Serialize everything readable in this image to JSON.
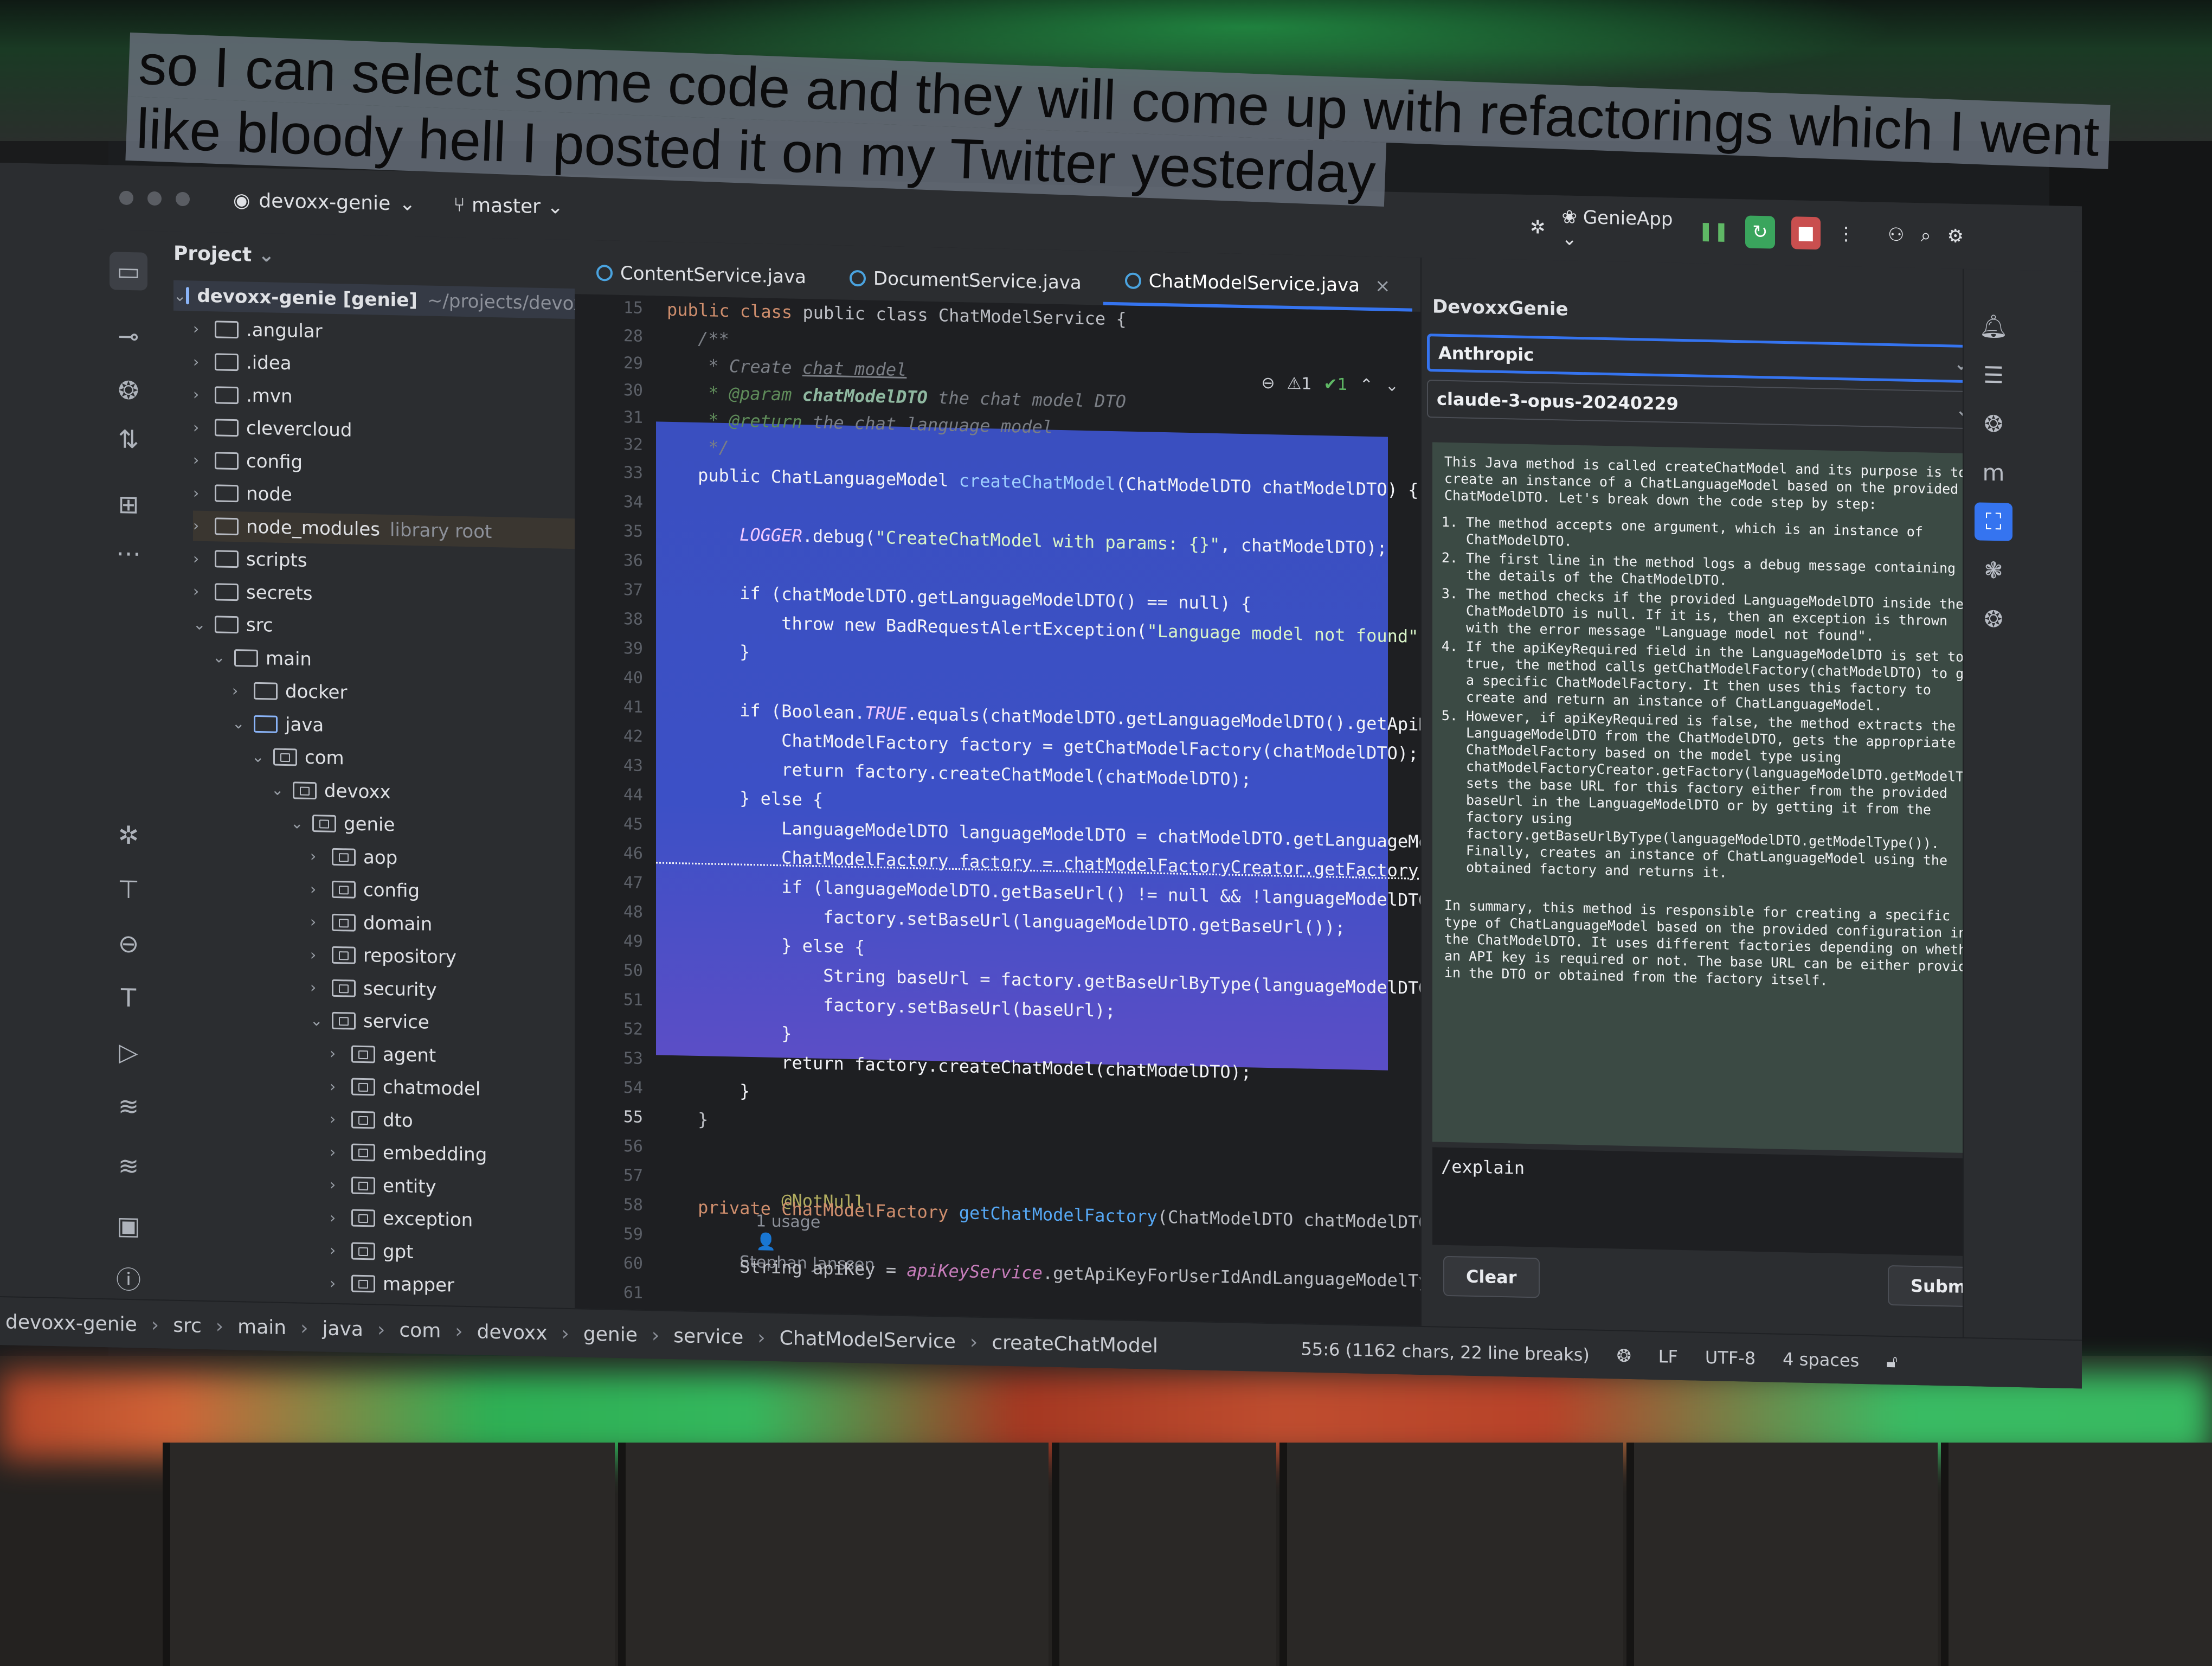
{
  "caption": {
    "line1": "so I can select some code and they will come up with refactorings which I went",
    "line2": "like bloody hell I posted it on my Twitter yesterday"
  },
  "titlebar": {
    "project_name": "devoxx-genie",
    "branch": "master"
  },
  "project_panel": {
    "title": "Project",
    "tree": [
      {
        "label": "devoxx-genie [genie]",
        "hint": "~/projects/devoxx",
        "depth": 0,
        "expanded": true,
        "kind": "module"
      },
      {
        "label": ".angular",
        "depth": 1,
        "kind": "folder"
      },
      {
        "label": ".idea",
        "depth": 1,
        "kind": "folder"
      },
      {
        "label": ".mvn",
        "depth": 1,
        "kind": "folder"
      },
      {
        "label": "clevercloud",
        "depth": 1,
        "kind": "folder"
      },
      {
        "label": "config",
        "depth": 1,
        "kind": "folder"
      },
      {
        "label": "node",
        "depth": 1,
        "kind": "folder"
      },
      {
        "label": "node_modules",
        "hint": "library root",
        "depth": 1,
        "kind": "folder"
      },
      {
        "label": "scripts",
        "depth": 1,
        "kind": "folder"
      },
      {
        "label": "secrets",
        "depth": 1,
        "kind": "folder"
      },
      {
        "label": "src",
        "depth": 1,
        "expanded": true,
        "kind": "folder"
      },
      {
        "label": "main",
        "depth": 2,
        "expanded": true,
        "kind": "folder"
      },
      {
        "label": "docker",
        "depth": 3,
        "kind": "folder"
      },
      {
        "label": "java",
        "depth": 3,
        "expanded": true,
        "kind": "module"
      },
      {
        "label": "com",
        "depth": 4,
        "expanded": true,
        "kind": "package"
      },
      {
        "label": "devoxx",
        "depth": 5,
        "expanded": true,
        "kind": "package"
      },
      {
        "label": "genie",
        "depth": 6,
        "expanded": true,
        "kind": "package"
      },
      {
        "label": "aop",
        "depth": 7,
        "kind": "package"
      },
      {
        "label": "config",
        "depth": 7,
        "kind": "package"
      },
      {
        "label": "domain",
        "depth": 7,
        "kind": "package"
      },
      {
        "label": "repository",
        "depth": 7,
        "kind": "package"
      },
      {
        "label": "security",
        "depth": 7,
        "kind": "package"
      },
      {
        "label": "service",
        "depth": 7,
        "expanded": true,
        "kind": "package"
      },
      {
        "label": "agent",
        "depth": 8,
        "kind": "package"
      },
      {
        "label": "chatmodel",
        "depth": 8,
        "kind": "package"
      },
      {
        "label": "dto",
        "depth": 8,
        "kind": "package"
      },
      {
        "label": "embedding",
        "depth": 8,
        "kind": "package"
      },
      {
        "label": "entity",
        "depth": 8,
        "kind": "package"
      },
      {
        "label": "exception",
        "depth": 8,
        "kind": "package"
      },
      {
        "label": "gpt",
        "depth": 8,
        "kind": "package"
      },
      {
        "label": "mapper",
        "depth": 8,
        "kind": "package"
      }
    ]
  },
  "editor": {
    "tabs": [
      {
        "label": "ContentService.java",
        "active": false
      },
      {
        "label": "DocumentService.java",
        "active": false
      },
      {
        "label": "ChatModelService.java",
        "active": true,
        "close": "×"
      }
    ],
    "inspections": {
      "warnings": "⚠1",
      "ok": "✔1"
    },
    "line_numbers": [
      "15",
      "28",
      "29",
      "30",
      "31",
      "32",
      "33",
      "34",
      "35",
      "36",
      "37",
      "38",
      "39",
      "40",
      "41",
      "42",
      "43",
      "44",
      "45",
      "46",
      "47",
      "48",
      "49",
      "50",
      "51",
      "52",
      "53",
      "54",
      "55",
      "56",
      "57",
      "58",
      "59",
      "60",
      "61"
    ],
    "current_line": "55",
    "code": {
      "l15": "public class ChatModelService {",
      "l28": "    /**",
      "l29_a": "     * Create ",
      "l29_b": "chat model",
      "l30_a": "     * @param ",
      "l30_b": "chatModelDTO",
      "l30_c": " the chat model DTO",
      "l31_a": "     * @return",
      "l31_b": " the chat language model",
      "l32": "     */",
      "l33_a": "    public ChatLanguageModel ",
      "l33_b": "createChatModel",
      "l33_c": "(ChatModelDTO chatModelDTO) {",
      "l34": "",
      "l35_a": "        LOGGER",
      "l35_b": ".debug(",
      "l35_c": "\"CreateChatModel with params: {}\"",
      "l35_d": ", chatModelDTO);",
      "l36": "",
      "l37": "        if (chatModelDTO.getLanguageModelDTO() == null) {",
      "l38_a": "            throw new BadRequestAlertException(",
      "l38_b": "\"Language model not found\",",
      "l39": "        }",
      "l40": "",
      "l41_a": "        if (Boolean.",
      "l41_b": "TRUE",
      "l41_c": ".equals(chatModelDTO.getLanguageModelDTO().getApiKe",
      "l42": "            ChatModelFactory factory = getChatModelFactory(chatModelDTO);",
      "l43": "            return factory.createChatModel(chatModelDTO);",
      "l44": "        } else {",
      "l45": "            LanguageModelDTO languageModelDTO = chatModelDTO.getLanguageMod",
      "l46": "            ChatModelFactory factory = chatModelFactoryCreator.getFactory(l",
      "l47": "            if (languageModelDTO.getBaseUrl() != null && !languageModelDTO.",
      "l48": "                factory.setBaseUrl(languageModelDTO.getBaseUrl());",
      "l49": "            } else {",
      "l50": "                String baseUrl = factory.getBaseUrlByType(languageModelDTO.",
      "l51": "                factory.setBaseUrl(baseUrl);",
      "l52": "            }",
      "l53": "            return factory.createChatModel(chatModelDTO);",
      "l54": "        }",
      "l55": "    }",
      "l56": "",
      "l57_ann": "    @NotNull",
      "l57_meta1": "1 usage",
      "l57_meta2": "Stephan Janssen",
      "l58_a": "    private ChatModelFactory ",
      "l58_b": "getChatModelFactory",
      "l58_c": "(ChatModelDTO chatModelDTO) {",
      "l59": "",
      "l60_a": "        String apiKey = ",
      "l60_b": "apiKeyService",
      "l60_c": ".getApiKeyForUserIdAndLanguageModelTyp",
      "l61": ""
    }
  },
  "plugin": {
    "run_config": "GenieApp",
    "title": "DevoxxGenie",
    "provider": "Anthropic",
    "model": "claude-3-opus-20240229",
    "answer": {
      "intro": "This Java method is called createChatModel and its purpose is to create an instance of a ChatLanguageModel based on the provided ChatModelDTO. Let's break down the code step by step:",
      "steps": [
        "The method accepts one argument, which is an instance of ChatModelDTO.",
        "The first line in the method logs a debug message containing the details of the ChatModelDTO.",
        "The method checks if the provided LanguageModelDTO inside the ChatModelDTO is null. If it is, then an exception is thrown with the error message \"Language model not found\".",
        "If the apiKeyRequired field in the LanguageModelDTO is set to true, the method calls getChatModelFactory(chatModelDTO) to get a specific ChatModelFactory. It then uses this factory to create and return an instance of ChatLanguageModel.",
        "However, if apiKeyRequired is false, the method extracts the LanguageModelDTO from the ChatModelDTO, gets the appropriate ChatModelFactory based on the model type using chatModelFactoryCreator.getFactory(languageModelDTO.getModelType()), sets the base URL for this factory either from the provided baseUrl in the LanguageModelDTO or by getting it from the factory using factory.getBaseUrlByType(languageModelDTO.getModelType()). Finally, creates an instance of ChatLanguageModel using the obtained factory and returns it."
      ],
      "summary": "In summary, this method is responsible for creating a specific type of ChatLanguageModel based on the provided configuration in the ChatModelDTO. It uses different factories depending on whether an API key is required or not. The base URL can be either provided in the DTO or obtained from the factory itself."
    },
    "prompt": "/explain",
    "clear_label": "Clear",
    "submit_label": "Submit"
  },
  "statusbar": {
    "breadcrumb": [
      "devoxx-genie",
      "src",
      "main",
      "java",
      "com",
      "devoxx",
      "genie",
      "service",
      "ChatModelService",
      "createChatModel"
    ],
    "caret": "55:6 (1162 chars, 22 line breaks)",
    "line_sep": "LF",
    "encoding": "UTF-8",
    "indent": "4 spaces"
  },
  "colors": {
    "ide_bg": "#2b2d30",
    "editor_bg": "#1e1f22",
    "selection": "#3c50c6",
    "accent": "#3574f0",
    "answer_bg": "#3b4a44"
  }
}
